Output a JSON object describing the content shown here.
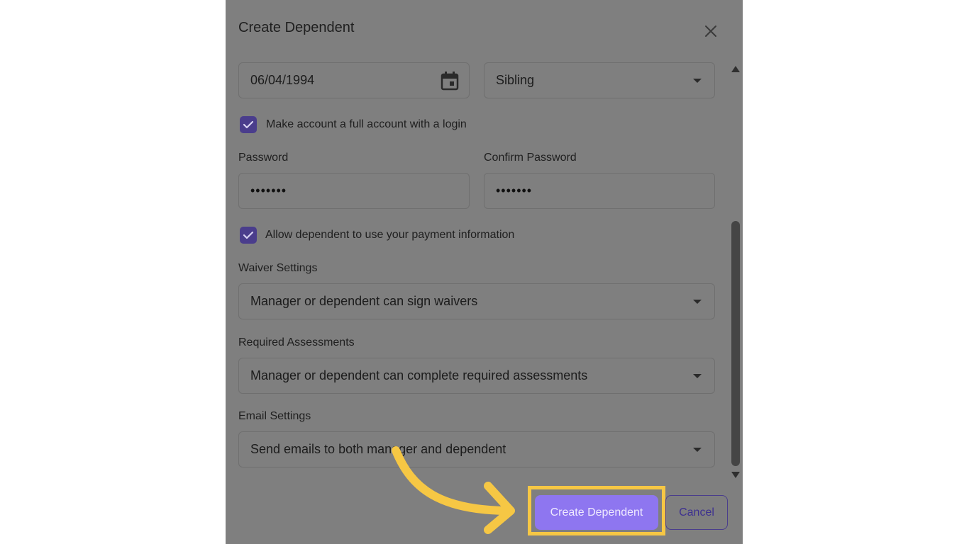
{
  "modal": {
    "title": "Create Dependent"
  },
  "form": {
    "birthdate": {
      "value": "06/04/1994"
    },
    "relationship": {
      "value": "Sibling"
    },
    "full_account": {
      "label": "Make account a full account with a login",
      "checked": true
    },
    "password": {
      "label": "Password",
      "value": "•••••••"
    },
    "confirm_password": {
      "label": "Confirm Password",
      "value": "•••••••"
    },
    "payment": {
      "label": "Allow dependent to use your payment information",
      "checked": true
    },
    "waiver": {
      "label": "Waiver Settings",
      "value": "Manager or dependent can sign waivers"
    },
    "assessments": {
      "label": "Required Assessments",
      "value": "Manager or dependent can complete required assessments"
    },
    "email": {
      "label": "Email Settings",
      "value": "Send emails to both manager and dependent"
    }
  },
  "actions": {
    "create_label": "Create Dependent",
    "cancel_label": "Cancel"
  },
  "colors": {
    "accent": "#8e76f0",
    "checkbox": "#4a3d8c",
    "highlight": "#f6c744",
    "overlay": "#7f7f7f"
  },
  "icons": {
    "close": "close-icon",
    "calendar": "calendar-icon",
    "check": "check-icon",
    "dropdown": "chevron-down-icon",
    "pointer": "curved-arrow-icon"
  }
}
